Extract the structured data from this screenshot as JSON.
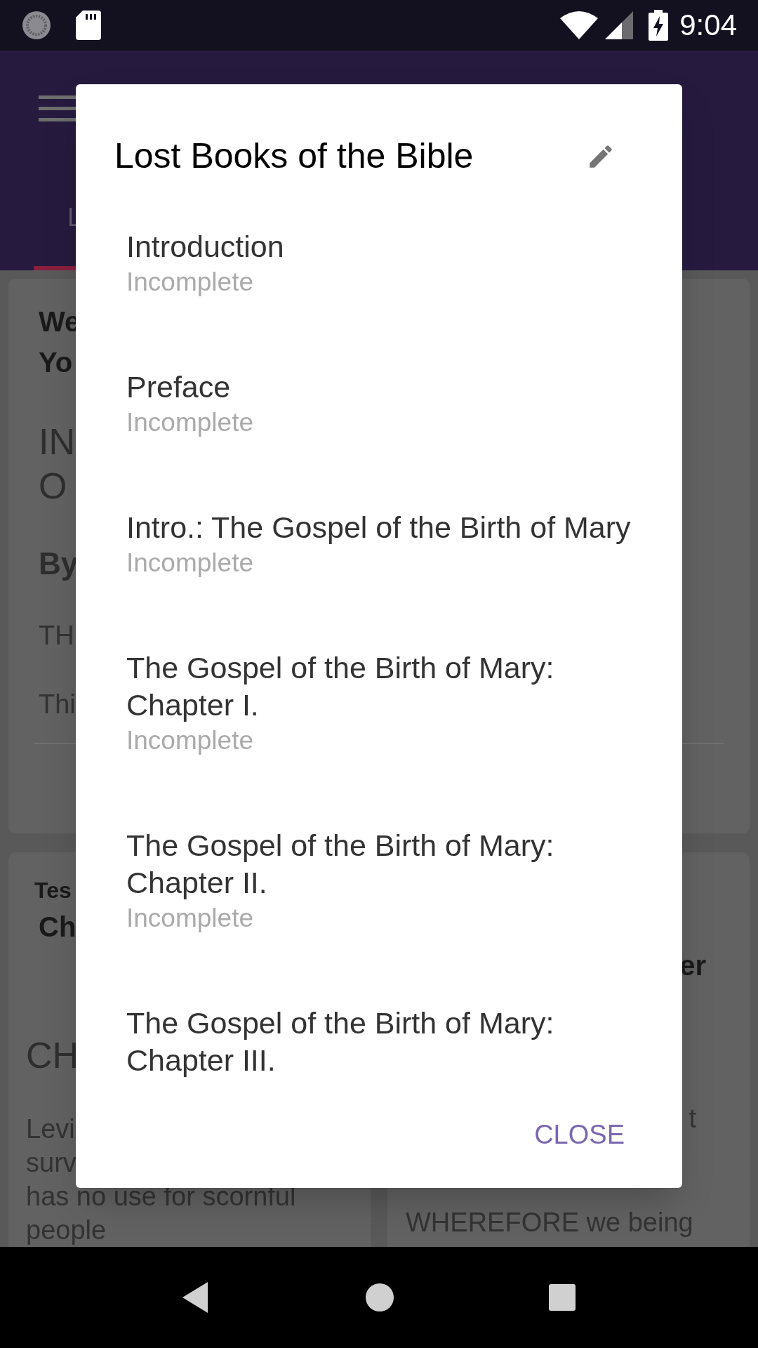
{
  "status_bar": {
    "time": "9:04"
  },
  "background": {
    "tab_label": "L",
    "card_1": [
      "We",
      "Yo",
      "IN",
      "O",
      "By",
      "TH",
      "Thi"
    ],
    "card_2_left": [
      "Tes",
      "Ch",
      "CH",
      "Levi",
      "surv",
      "has no use for scornful",
      "people"
    ],
    "card_2_right": [
      "er",
      "t",
      "WHEREFORE we being"
    ]
  },
  "dialog": {
    "title": "Lost Books of the Bible",
    "items": [
      {
        "title": "Introduction",
        "status": "Incomplete"
      },
      {
        "title": "Preface",
        "status": "Incomplete"
      },
      {
        "title": "Intro.: The Gospel of the Birth of Mary",
        "status": "Incomplete"
      },
      {
        "title": "The Gospel of the Birth of Mary: Chapter I.",
        "status": "Incomplete"
      },
      {
        "title": "The Gospel of the Birth of Mary: Chapter II.",
        "status": "Incomplete"
      },
      {
        "title": "The Gospel of the Birth of Mary: Chapter III."
      }
    ],
    "button": "CLOSE"
  }
}
